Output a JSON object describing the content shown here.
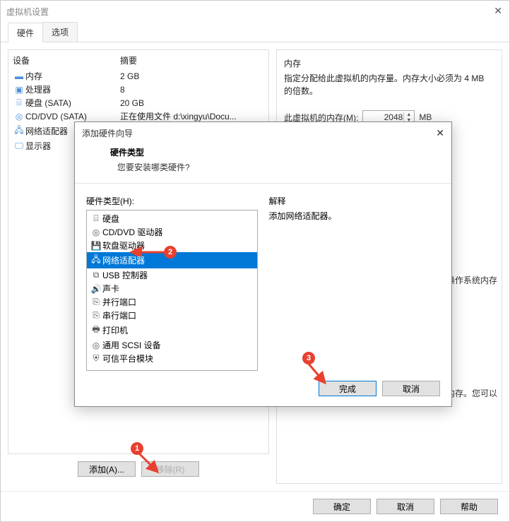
{
  "window": {
    "title": "虚拟机设置"
  },
  "tabs": {
    "hardware": "硬件",
    "options": "选项"
  },
  "columns": {
    "device": "设备",
    "summary": "摘要"
  },
  "devices": [
    {
      "icon": "▬",
      "name": "内存",
      "summary": "2 GB"
    },
    {
      "icon": "▣",
      "name": "处理器",
      "summary": "8"
    },
    {
      "icon": "⌸",
      "name": "硬盘 (SATA)",
      "summary": "20 GB"
    },
    {
      "icon": "◎",
      "name": "CD/DVD (SATA)",
      "summary": "正在使用文件 d:\\xingyu\\Docu..."
    },
    {
      "icon": "🖧",
      "name": "网络适配器",
      "summary": ""
    },
    {
      "icon": "🖵",
      "name": "显示器",
      "summary": ""
    }
  ],
  "panelButtons": {
    "add": "添加(A)...",
    "remove": "移除(R)"
  },
  "memory": {
    "groupTitle": "内存",
    "desc": "指定分配给此虚拟机的内存量。内存大小必须为 4 MB 的倍数。",
    "label": "此虚拟机的内存(M):",
    "value": "2048",
    "unit": "MB",
    "sideNote1": "操作系统内存",
    "sideNote2": "}内存。您可以"
  },
  "bottomButtons": {
    "ok": "确定",
    "cancel": "取消",
    "help": "帮助"
  },
  "dialog": {
    "title": "添加硬件向导",
    "hwType": "硬件类型",
    "question": "您要安装哪类硬件?",
    "listLabel": "硬件类型(H):",
    "explainLabel": "解释",
    "explainText": "添加网络适配器。",
    "items": [
      {
        "icon": "⌸",
        "label": "硬盘"
      },
      {
        "icon": "◎",
        "label": "CD/DVD 驱动器"
      },
      {
        "icon": "💾",
        "label": "软盘驱动器"
      },
      {
        "icon": "🖧",
        "label": "网络适配器"
      },
      {
        "icon": "⧉",
        "label": "USB 控制器"
      },
      {
        "icon": "🔊",
        "label": "声卡"
      },
      {
        "icon": "⎘",
        "label": "并行端口"
      },
      {
        "icon": "⎘",
        "label": "串行端口"
      },
      {
        "icon": "🖶",
        "label": "打印机"
      },
      {
        "icon": "◎",
        "label": "通用 SCSI 设备"
      },
      {
        "icon": "⛨",
        "label": "可信平台模块"
      }
    ],
    "selectedIndex": 3,
    "buttons": {
      "finish": "完成",
      "cancel": "取消"
    }
  },
  "annotations": {
    "a1": "1",
    "a2": "2",
    "a3": "3"
  }
}
